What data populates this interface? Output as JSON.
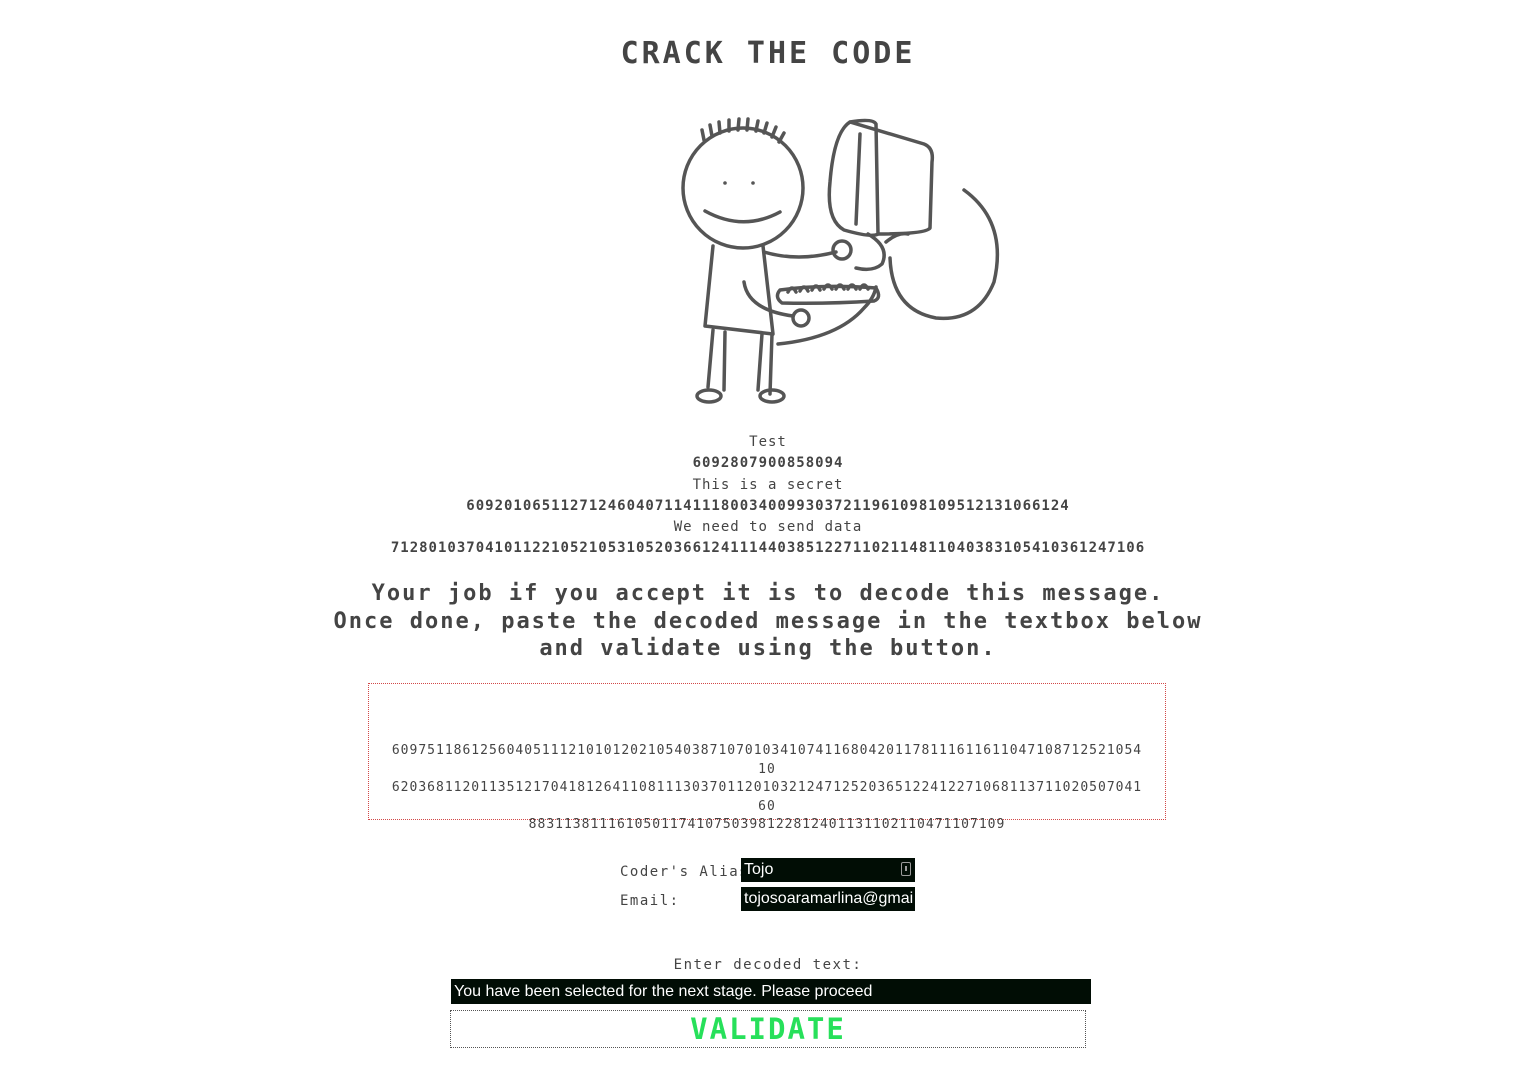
{
  "title": "CRACK THE CODE",
  "illustration": "stick-figure-with-computer",
  "examples": [
    {
      "plain": "Test",
      "code": "6092807900858094"
    },
    {
      "plain": "This is a secret",
      "code": "6092010651127124604071141118003400993037211961098109512131066124"
    },
    {
      "plain": "We need to send data",
      "code": "7128010370410112210521053105203661241114403851227110211481104038310541036124710​6"
    }
  ],
  "instructions": [
    "Your job if you accept it is to decode this message.",
    "Once done, paste the decoded message in the textbox below",
    "and validate using the button."
  ],
  "message": {
    "lines": [
      "609751186125604051112101012021054038710701034107411680420117811161161104710871252105410",
      "620368112011351217041812641108111303701120103212471252036512241227106811371102050704160",
      "88311381116105011741075039812281240113110211047110710​9"
    ]
  },
  "form": {
    "alias_label": "Coder's Alias:",
    "alias_value": "Tojo",
    "email_label": "Email:",
    "email_value": "tojosoaramarlina@gmai"
  },
  "decoded": {
    "label": "Enter decoded text:",
    "value": "You have been selected for the next stage. Please proceed"
  },
  "button": {
    "label": "VALIDATE",
    "color": "#27e05a"
  }
}
